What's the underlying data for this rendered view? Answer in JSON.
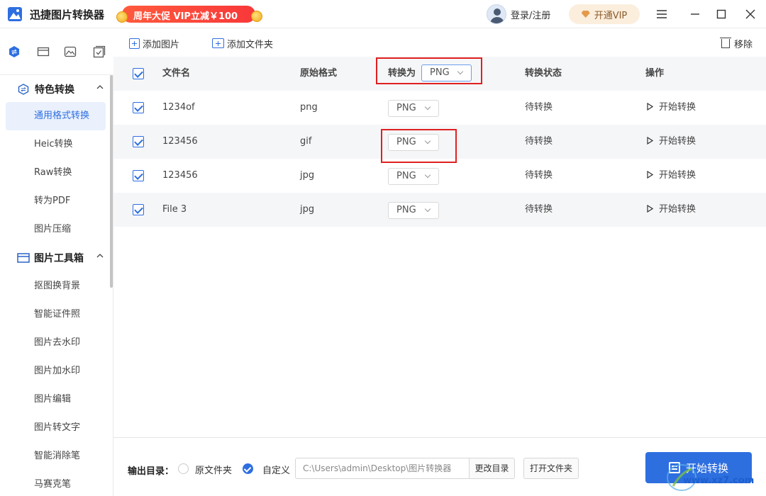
{
  "app": {
    "title": "迅捷图片转换器",
    "promo": "周年大促 VIP立减￥100",
    "login": "登录/注册",
    "vip": "开通VIP"
  },
  "icons": {
    "rail": [
      "convert-icon",
      "toolbox-icon",
      "image-icon",
      "checklist-icon"
    ],
    "window": [
      "menu-icon",
      "minimize-icon",
      "maximize-icon",
      "close-icon"
    ]
  },
  "sidebar": {
    "groups": [
      {
        "label": "特色转换",
        "items": [
          "通用格式转换",
          "Heic转换",
          "Raw转换",
          "转为PDF",
          "图片压缩"
        ]
      },
      {
        "label": "图片工具箱",
        "items": [
          "抠图换背景",
          "智能证件照",
          "图片去水印",
          "图片加水印",
          "图片编辑",
          "图片转文字",
          "智能消除笔",
          "马赛克笔"
        ]
      }
    ],
    "active_item": "通用格式转换"
  },
  "toolbar": {
    "add_image": "添加图片",
    "add_folder": "添加文件夹",
    "remove": "移除"
  },
  "table": {
    "headers": {
      "filename": "文件名",
      "original": "原始格式",
      "convert_to": "转换为",
      "status": "转换状态",
      "action": "操作"
    },
    "global_format": "PNG",
    "rows": [
      {
        "checked": true,
        "filename": "1234of",
        "original": "png",
        "target": "PNG",
        "status": "待转换",
        "action": "开始转换"
      },
      {
        "checked": true,
        "filename": "123456",
        "original": "gif",
        "target": "PNG",
        "status": "待转换",
        "action": "开始转换"
      },
      {
        "checked": true,
        "filename": "123456",
        "original": "jpg",
        "target": "PNG",
        "status": "待转换",
        "action": "开始转换"
      },
      {
        "checked": true,
        "filename": "File 3",
        "original": "jpg",
        "target": "PNG",
        "status": "待转换",
        "action": "开始转换"
      }
    ]
  },
  "footer": {
    "output_label": "输出目录：",
    "option_original": "原文件夹",
    "option_custom": "自定义",
    "selected_option": "自定义",
    "path": "C:\\Users\\admin\\Desktop\\图片转换器",
    "change_dir": "更改目录",
    "open_folder": "打开文件夹",
    "start_all": "开始转换"
  },
  "watermark": {
    "text": "www.xz7.com"
  },
  "colors": {
    "accent": "#2e6fe0",
    "highlight": "#e02020",
    "promo": "#f8383a"
  }
}
